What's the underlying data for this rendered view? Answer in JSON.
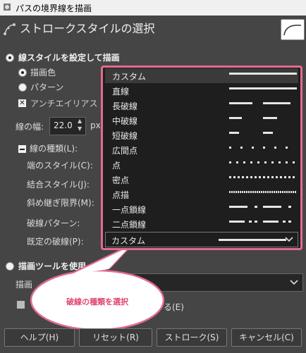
{
  "window": {
    "title": "パスの境界線を描画"
  },
  "header": {
    "title": "ストロークスタイルの選択"
  },
  "stroke_line": {
    "label": "線スタイルを設定して描画",
    "solid_label": "描画色",
    "pattern_label": "パターン",
    "antialias_label": "アンチエイリアス",
    "width_label": "線の幅:",
    "width_value": "22.0",
    "width_unit": "px",
    "line_style_label": "線の種類(L):",
    "cap_label": "端のスタイル(C):",
    "join_label": "結合スタイル(J):",
    "miter_label": "斜め継ぎ限界(M):",
    "dash_pattern_label": "破線パターン:",
    "dash_preset_label": "既定の破線(P):"
  },
  "dash_dropdown": {
    "items": [
      {
        "label": "カスタム",
        "pattern": "solid",
        "selected": true
      },
      {
        "label": "直線",
        "pattern": "solid",
        "selected": false
      },
      {
        "label": "長破線",
        "pattern": "long",
        "selected": false
      },
      {
        "label": "中破線",
        "pattern": "medium",
        "selected": false
      },
      {
        "label": "短破線",
        "pattern": "short",
        "selected": false
      },
      {
        "label": "広間点",
        "pattern": "sparse",
        "selected": false
      },
      {
        "label": "点",
        "pattern": "normal",
        "selected": false
      },
      {
        "label": "密点",
        "pattern": "dense",
        "selected": false
      },
      {
        "label": "点描",
        "pattern": "stipples",
        "selected": false
      },
      {
        "label": "一点鎖線",
        "pattern": "dashdot",
        "selected": false
      },
      {
        "label": "二点鎖線",
        "pattern": "dashdotdot",
        "selected": false
      }
    ],
    "current_label": "カスタム"
  },
  "paint_tool": {
    "label": "描画ツールを使用",
    "tool_label": "描画",
    "emulate_label": "る(E)"
  },
  "callout": {
    "text": "破線の種類を選択"
  },
  "buttons": {
    "help": "ヘルプ(H)",
    "reset": "リセット(R)",
    "stroke": "ストローク(S)",
    "cancel": "キャンセル(C)"
  },
  "colors": {
    "accent": "#e36b8d",
    "callout_text": "#e0466f"
  }
}
